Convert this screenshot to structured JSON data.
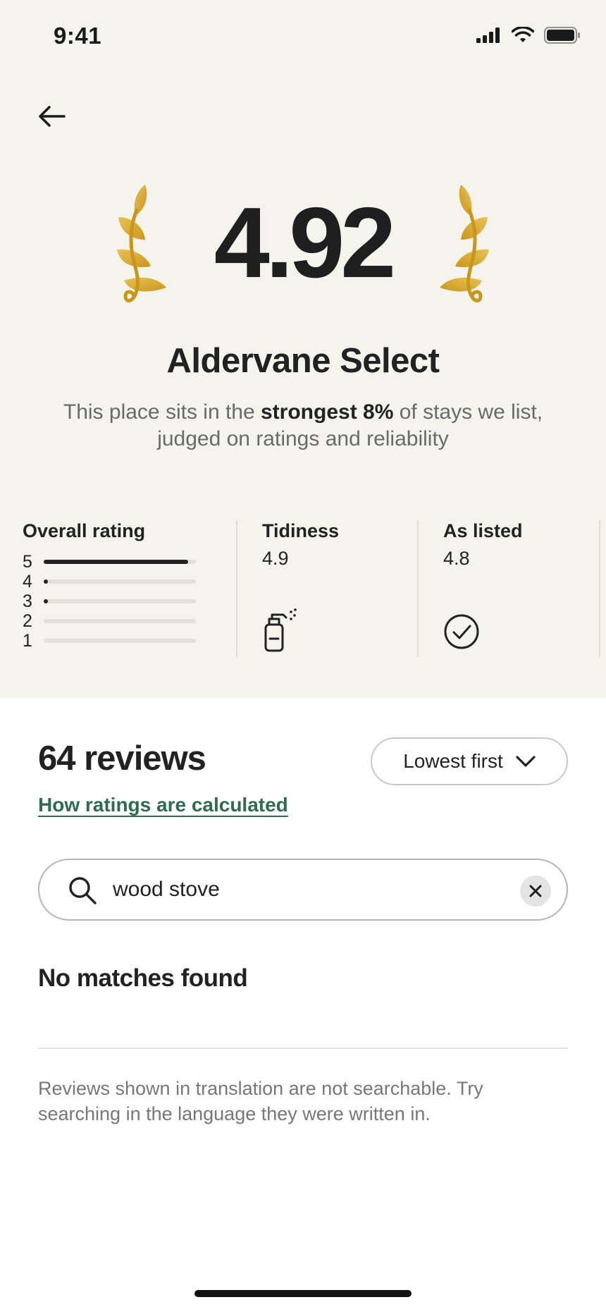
{
  "status_bar": {
    "time": "9:41"
  },
  "header": {
    "back_icon": "arrow-left-icon",
    "score": "4.92",
    "laurel_icon": "laurel-icon",
    "laurel_color": "#d9ad2f",
    "place_name": "Aldervane Select",
    "description_before": "This place sits in the ",
    "description_bold": "strongest 8%",
    "description_after": " of stays we list, judged on ratings and reliability"
  },
  "metrics": {
    "overall": {
      "title": "Overall rating",
      "distribution": [
        {
          "label": "5",
          "fraction": 0.95
        },
        {
          "label": "4",
          "fraction": 0.03
        },
        {
          "label": "3",
          "fraction": 0.02
        },
        {
          "label": "2",
          "fraction": 0
        },
        {
          "label": "1",
          "fraction": 0
        }
      ]
    },
    "tidiness": {
      "title": "Tidiness",
      "value": "4.9",
      "icon": "spray-bottle-icon"
    },
    "as_listed": {
      "title": "As listed",
      "value": "4.8",
      "icon": "check-circle-icon"
    }
  },
  "reviews": {
    "count_label": "64 reviews",
    "sort_label": "Lowest first",
    "calc_link": "How ratings are calculated",
    "link_color": "#2f6b52"
  },
  "search": {
    "value": "wood stove",
    "search_icon": "search-icon",
    "clear_icon": "close-icon"
  },
  "results": {
    "empty_title": "No matches found",
    "note": "Reviews shown in translation are not searchable. Try searching in the language they were written in."
  }
}
